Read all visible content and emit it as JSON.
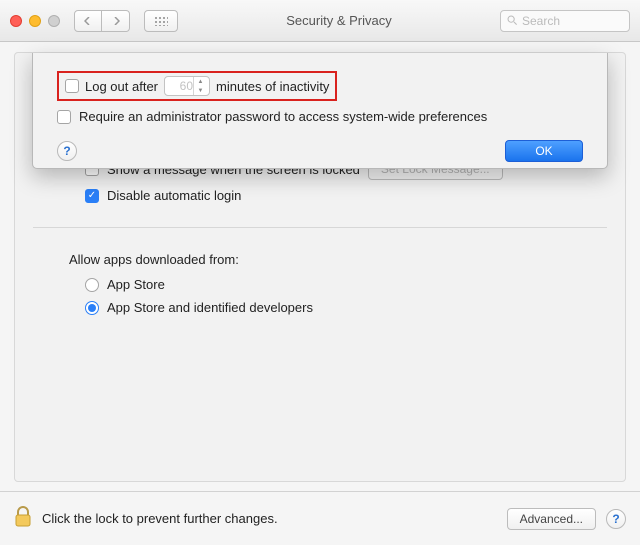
{
  "toolbar": {
    "title": "Security & Privacy",
    "search_placeholder": "Search"
  },
  "sheet": {
    "logout_prefix": "Log out after",
    "logout_minutes": "60",
    "logout_suffix": "minutes of inactivity",
    "admin_pw_label": "Require an administrator password to access system-wide preferences",
    "ok_label": "OK"
  },
  "main": {
    "screen_msg_label": "Show a message when the screen is locked",
    "set_lock_label": "Set Lock Message...",
    "disable_auto_login_label": "Disable automatic login"
  },
  "allow": {
    "header": "Allow apps downloaded from:",
    "opt1": "App Store",
    "opt2": "App Store and identified developers"
  },
  "footer": {
    "lock_text": "Click the lock to prevent further changes.",
    "advanced_label": "Advanced..."
  }
}
